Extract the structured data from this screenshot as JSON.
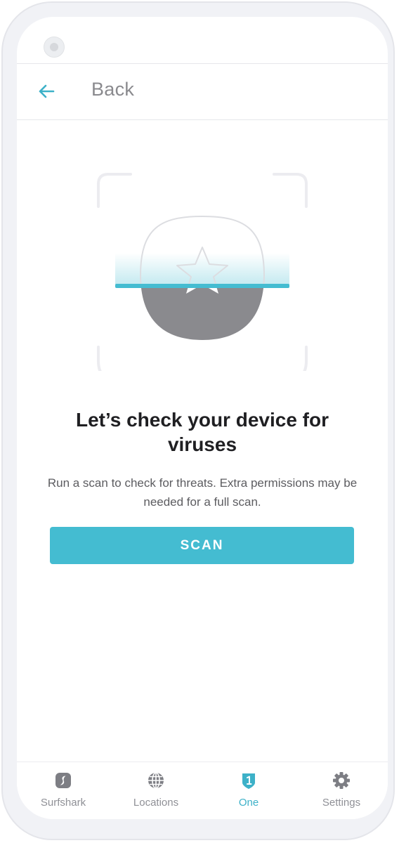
{
  "header": {
    "back_label": "Back"
  },
  "main": {
    "headline": "Let’s check your device for viruses",
    "description": "Run a scan to check for threats. Extra permissions may be needed for a full scan.",
    "scan_button": "SCAN"
  },
  "bottom_nav": [
    {
      "label": "Surfshark",
      "icon": "surfshark-logo-icon",
      "active": false
    },
    {
      "label": "Locations",
      "icon": "globe-icon",
      "active": false
    },
    {
      "label": "One",
      "icon": "shield-one-icon",
      "active": true
    },
    {
      "label": "Settings",
      "icon": "gear-icon",
      "active": false
    }
  ],
  "colors": {
    "accent": "#44bcd1",
    "active_tab": "#3db1c8",
    "badge_fill": "#8a8a8e",
    "text_dark": "#1f1f22",
    "text_muted": "#5c5c60"
  },
  "icons": {
    "back": "arrow-left-icon",
    "illustration": "scan-frame-star-badge"
  }
}
